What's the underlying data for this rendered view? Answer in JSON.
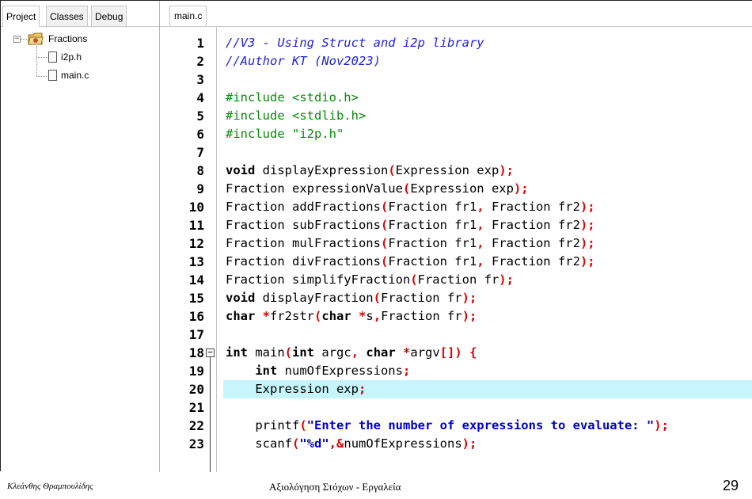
{
  "left_panel": {
    "tabs": [
      "Project",
      "Classes",
      "Debug"
    ],
    "active_tab": "Project",
    "tree": {
      "project": "Fractions",
      "files": [
        "i2p.h",
        "main.c"
      ]
    }
  },
  "editor": {
    "tab": "main.c",
    "highlighted_line": 20,
    "lines": [
      {
        "n": "1",
        "segs": [
          [
            "c",
            "//V3 - Using Struct and i2p library"
          ]
        ]
      },
      {
        "n": "2",
        "segs": [
          [
            "c",
            "//Author KT (Nov2023)"
          ]
        ]
      },
      {
        "n": "3",
        "segs": []
      },
      {
        "n": "4",
        "segs": [
          [
            "p",
            "#include <stdio.h>"
          ]
        ]
      },
      {
        "n": "5",
        "segs": [
          [
            "p",
            "#include <stdlib.h>"
          ]
        ]
      },
      {
        "n": "6",
        "segs": [
          [
            "p",
            "#include \"i2p.h\""
          ]
        ]
      },
      {
        "n": "7",
        "segs": []
      },
      {
        "n": "8",
        "segs": [
          [
            "k",
            "void"
          ],
          [
            "n",
            " displayExpression"
          ],
          [
            "r",
            "("
          ],
          [
            "n",
            "Expression exp"
          ],
          [
            "r",
            ");"
          ]
        ]
      },
      {
        "n": "9",
        "segs": [
          [
            "n",
            "Fraction expressionValue"
          ],
          [
            "r",
            "("
          ],
          [
            "n",
            "Expression exp"
          ],
          [
            "r",
            ");"
          ]
        ]
      },
      {
        "n": "10",
        "segs": [
          [
            "n",
            "Fraction addFractions"
          ],
          [
            "r",
            "("
          ],
          [
            "n",
            "Fraction fr1"
          ],
          [
            "r",
            ","
          ],
          [
            "n",
            " Fraction fr2"
          ],
          [
            "r",
            ");"
          ]
        ]
      },
      {
        "n": "11",
        "segs": [
          [
            "n",
            "Fraction subFractions"
          ],
          [
            "r",
            "("
          ],
          [
            "n",
            "Fraction fr1"
          ],
          [
            "r",
            ","
          ],
          [
            "n",
            " Fraction fr2"
          ],
          [
            "r",
            ");"
          ]
        ]
      },
      {
        "n": "12",
        "segs": [
          [
            "n",
            "Fraction mulFractions"
          ],
          [
            "r",
            "("
          ],
          [
            "n",
            "Fraction fr1"
          ],
          [
            "r",
            ","
          ],
          [
            "n",
            " Fraction fr2"
          ],
          [
            "r",
            ");"
          ]
        ]
      },
      {
        "n": "13",
        "segs": [
          [
            "n",
            "Fraction divFractions"
          ],
          [
            "r",
            "("
          ],
          [
            "n",
            "Fraction fr1"
          ],
          [
            "r",
            ","
          ],
          [
            "n",
            " Fraction fr2"
          ],
          [
            "r",
            ");"
          ]
        ]
      },
      {
        "n": "14",
        "segs": [
          [
            "n",
            "Fraction simplifyFraction"
          ],
          [
            "r",
            "("
          ],
          [
            "n",
            "Fraction fr"
          ],
          [
            "r",
            ");"
          ]
        ]
      },
      {
        "n": "15",
        "segs": [
          [
            "k",
            "void"
          ],
          [
            "n",
            " displayFraction"
          ],
          [
            "r",
            "("
          ],
          [
            "n",
            "Fraction fr"
          ],
          [
            "r",
            ");"
          ]
        ]
      },
      {
        "n": "16",
        "segs": [
          [
            "k",
            "char"
          ],
          [
            "n",
            " "
          ],
          [
            "r",
            "*"
          ],
          [
            "n",
            "fr2str"
          ],
          [
            "r",
            "("
          ],
          [
            "k",
            "char"
          ],
          [
            "n",
            " "
          ],
          [
            "r",
            "*"
          ],
          [
            "n",
            "s"
          ],
          [
            "r",
            ","
          ],
          [
            "n",
            "Fraction fr"
          ],
          [
            "r",
            ");"
          ]
        ]
      },
      {
        "n": "17",
        "segs": []
      },
      {
        "n": "18",
        "segs": [
          [
            "k",
            "int"
          ],
          [
            "n",
            " main"
          ],
          [
            "r",
            "("
          ],
          [
            "k",
            "int"
          ],
          [
            "n",
            " argc"
          ],
          [
            "r",
            ","
          ],
          [
            "n",
            " "
          ],
          [
            "k",
            "char"
          ],
          [
            "n",
            " "
          ],
          [
            "r",
            "*"
          ],
          [
            "n",
            "argv"
          ],
          [
            "r",
            "[])"
          ],
          [
            "n",
            " "
          ],
          [
            "r",
            "{"
          ]
        ]
      },
      {
        "n": "19",
        "segs": [
          [
            "n",
            "    "
          ],
          [
            "k",
            "int"
          ],
          [
            "n",
            " numOfExpressions"
          ],
          [
            "r",
            ";"
          ]
        ]
      },
      {
        "n": "20",
        "segs": [
          [
            "n",
            "    Expression exp"
          ],
          [
            "r",
            ";"
          ]
        ]
      },
      {
        "n": "21",
        "segs": []
      },
      {
        "n": "22",
        "segs": [
          [
            "n",
            "    printf"
          ],
          [
            "r",
            "("
          ],
          [
            "s",
            "\"Enter the number of expressions to evaluate: \""
          ],
          [
            "r",
            ");"
          ]
        ]
      },
      {
        "n": "23",
        "segs": [
          [
            "n",
            "    scanf"
          ],
          [
            "r",
            "("
          ],
          [
            "s",
            "\"%d\""
          ],
          [
            "r",
            ","
          ],
          [
            "r",
            "&"
          ],
          [
            "n",
            "numOfExpressions"
          ],
          [
            "r",
            ");"
          ]
        ]
      }
    ]
  },
  "footer": {
    "author": "Κλεάνθης Θραμπουλίδης",
    "title": "Αξιολόγηση Στόχων - Εργαλεία",
    "page": "29"
  },
  "colors": {
    "comment": "#2222dd",
    "preprocessor": "#0a8a0a",
    "symbol": "#e00000",
    "string": "#0000c8",
    "highlight": "#c6f5fb"
  }
}
